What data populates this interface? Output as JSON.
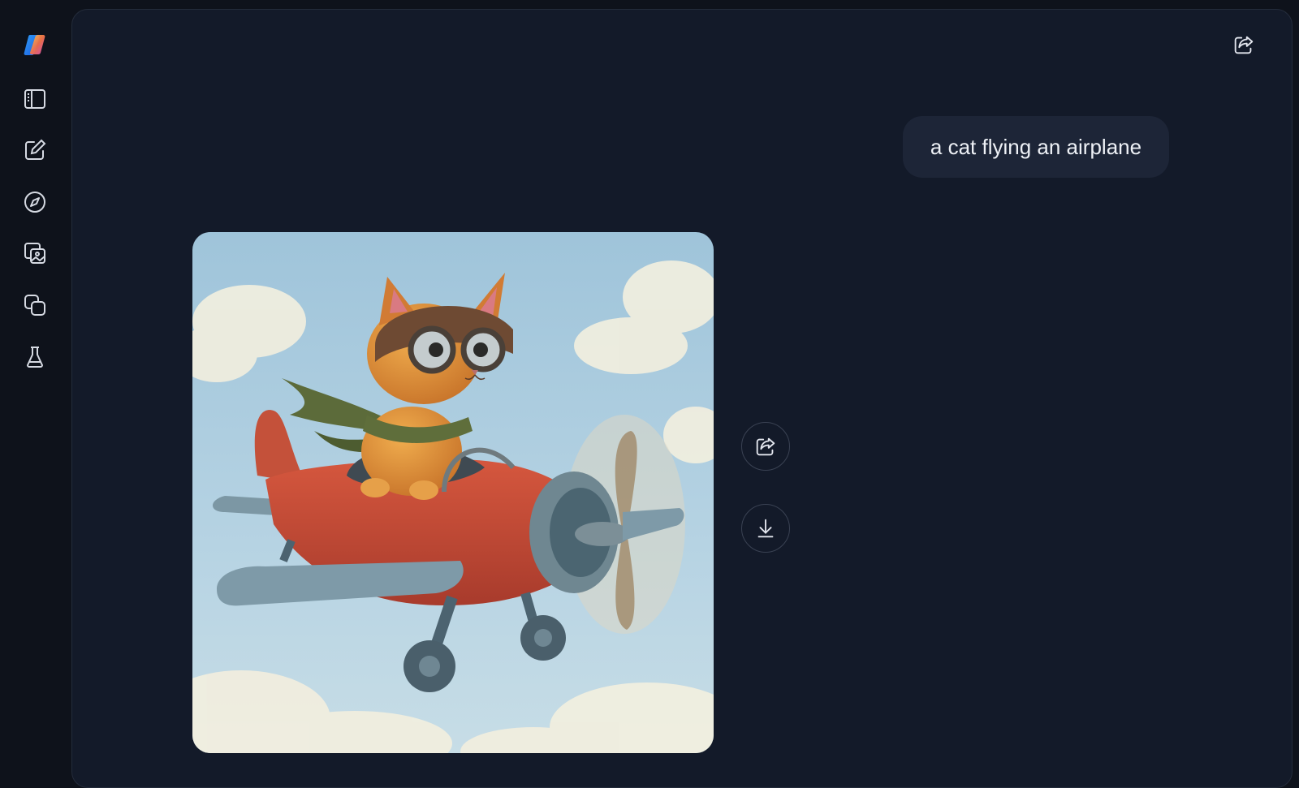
{
  "sidebar": {
    "items": [
      {
        "icon": "copilot-logo-icon"
      },
      {
        "icon": "sidebar-toggle-icon"
      },
      {
        "icon": "new-chat-icon"
      },
      {
        "icon": "discover-compass-icon"
      },
      {
        "icon": "image-gallery-icon"
      },
      {
        "icon": "pages-icon"
      },
      {
        "icon": "labs-flask-icon"
      }
    ]
  },
  "header": {
    "share_icon": "share-icon"
  },
  "conversation": {
    "user_message": "a cat flying an airplane",
    "response_image": {
      "actions": [
        {
          "icon": "share-icon"
        },
        {
          "icon": "download-icon"
        }
      ]
    }
  },
  "colors": {
    "background": "#0e121b",
    "panel": "#131a29",
    "bubble": "#1d2537",
    "text": "#eef1f6"
  }
}
